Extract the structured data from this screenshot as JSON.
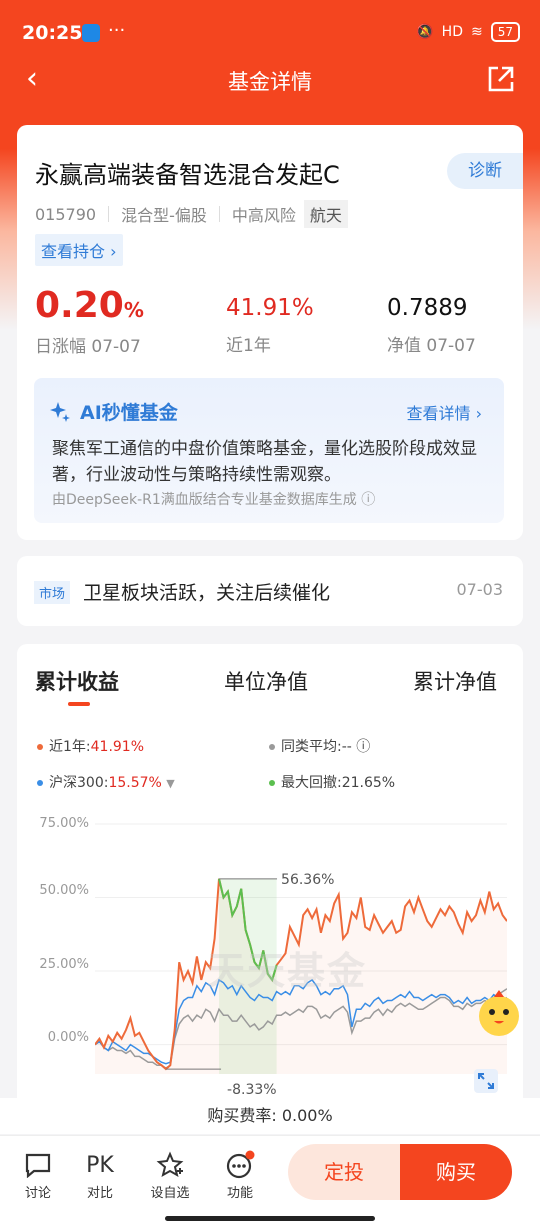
{
  "status": {
    "time": "20:25",
    "battery": "57",
    "signal": "HD",
    "dots": "···"
  },
  "nav": {
    "title": "基金详情"
  },
  "fund": {
    "name": "永赢高端装备智选混合发起C",
    "diagnose": "诊断",
    "code": "015790",
    "type": "混合型-偏股",
    "risk": "中高风险",
    "theme": "航天",
    "holdings": "查看持仓 ›"
  },
  "stats": {
    "day_change": "0.20",
    "day_change_unit": "%",
    "day_label": "日涨幅 07-07",
    "year_return": "41.91%",
    "year_label": "近1年",
    "nav_value": "0.7889",
    "nav_label": "净值 07-07"
  },
  "ai": {
    "title": "AI秒懂基金",
    "more": "查看详情 ›",
    "body": "聚焦军工通信的中盘价值策略基金，量化选股阶段成效显著，行业波动性与策略持续性需观察。",
    "footer": "由DeepSeek-R1满血版结合专业基金数据库生成 ⓘ"
  },
  "news": {
    "tag": "市场",
    "text": "卫星板块活跃，关注后续催化",
    "date": "07-03"
  },
  "chart_tabs": [
    "累计收益",
    "单位净值",
    "累计净值"
  ],
  "legend": {
    "fund_label": "近1年:",
    "fund_value": "41.91%",
    "avg_label": "同类平均:--",
    "index_label": "沪深300:",
    "index_value": "15.57%",
    "drawdown_label": "最大回撤:21.65%"
  },
  "colors": {
    "accent": "#f4451f",
    "fund": "#ee6a3a",
    "index": "#3a8ee6",
    "avg": "#9a9a9a",
    "drawdown": "#5bbf4f"
  },
  "chart_data": {
    "type": "line",
    "yticks": [
      "75.00%",
      "50.00%",
      "25.00%",
      "0.00%"
    ],
    "ylim": [
      -10,
      75
    ],
    "annotations": [
      "56.36%",
      "-8.33%"
    ],
    "watermark": "天天基金",
    "series": [
      {
        "name": "近1年",
        "values": [
          0,
          2,
          -1,
          3,
          1,
          4,
          2,
          5,
          9,
          3,
          4,
          1,
          -2,
          -4,
          -6,
          -7,
          -8.3,
          -7,
          5,
          28,
          22,
          25,
          21,
          30,
          22,
          28,
          26,
          36,
          56.4,
          50,
          52,
          44,
          47,
          53,
          39,
          34,
          28,
          26,
          32,
          24,
          22,
          27,
          29,
          31,
          40,
          37,
          34,
          44,
          46,
          43,
          46,
          38,
          44,
          42,
          48,
          51,
          36,
          38,
          45,
          43,
          50,
          40,
          39,
          44,
          41,
          38,
          40,
          42,
          38,
          39,
          47,
          49,
          45,
          50,
          46,
          42,
          40,
          43,
          46,
          44,
          47,
          45,
          41,
          38,
          45,
          42,
          44,
          49,
          45,
          52,
          46,
          48,
          44,
          42
        ]
      },
      {
        "name": "沪深300",
        "values": [
          0,
          1,
          -1,
          -2,
          1,
          0,
          -1,
          -2,
          0,
          -1,
          -2,
          -3,
          -3,
          -4,
          -5,
          -6,
          -6.5,
          -6,
          3,
          12,
          15,
          16,
          16,
          20,
          18,
          21,
          20,
          17,
          22,
          21,
          19,
          20,
          17,
          20,
          18,
          16,
          15,
          17,
          16,
          16,
          15,
          18,
          17,
          18,
          17,
          20,
          20,
          19,
          21,
          22,
          20,
          17,
          18,
          17,
          19,
          19,
          20,
          17,
          6,
          12,
          12,
          14,
          13,
          15,
          16,
          14,
          15,
          15,
          16,
          17,
          16,
          18,
          16,
          16,
          15,
          16,
          17,
          16,
          17,
          17,
          16,
          14,
          15,
          14,
          16,
          14,
          15,
          15,
          16,
          15,
          17,
          16,
          15,
          16
        ]
      },
      {
        "name": "同类平均",
        "values": [
          0,
          1,
          -1,
          -2,
          -1,
          -2,
          -2,
          -3,
          -2,
          -4,
          -4,
          -5,
          -6,
          -6,
          -7,
          -7,
          -8,
          -7,
          2,
          7,
          9,
          10,
          8,
          10,
          9,
          12,
          11,
          8,
          12,
          10,
          10,
          8,
          8,
          10,
          8,
          6,
          7,
          5,
          6,
          8,
          7,
          10,
          10,
          11,
          10,
          11,
          12,
          11,
          13,
          13,
          12,
          9,
          10,
          9,
          11,
          12,
          13,
          11,
          4,
          8,
          8,
          9,
          9,
          11,
          12,
          10,
          12,
          11,
          13,
          14,
          13,
          14,
          13,
          12,
          12,
          13,
          14,
          15,
          16,
          16,
          15,
          13,
          13,
          12,
          14,
          13,
          14,
          14,
          15,
          14,
          16,
          17,
          18,
          19
        ]
      }
    ]
  },
  "fee": {
    "text": "购买费率: 0.00%"
  },
  "bottom": {
    "discuss": "讨论",
    "pk_icon": "PK",
    "compare": "对比",
    "watchlist": "设自选",
    "functions": "功能",
    "dingtou": "定投",
    "buy": "购买"
  }
}
